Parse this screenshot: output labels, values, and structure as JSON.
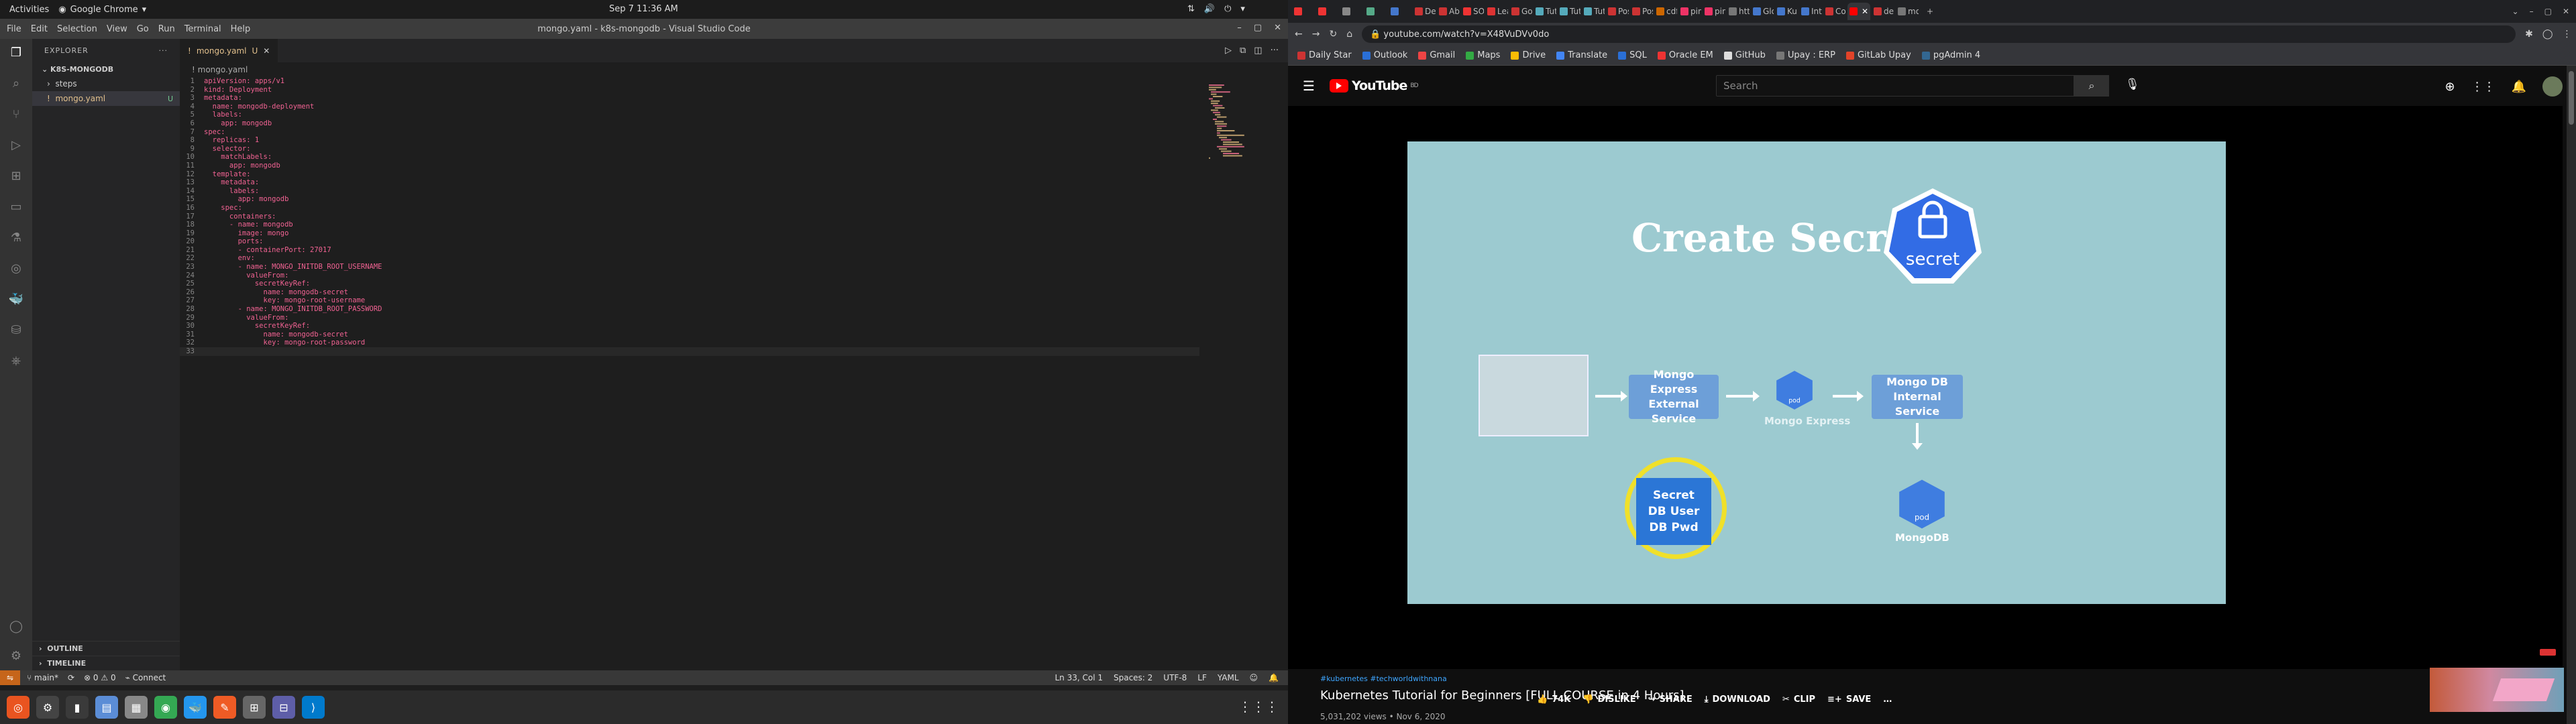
{
  "system": {
    "activities": "Activities",
    "app_name": "Google Chrome",
    "clock": "Sep 7  11:36 AM"
  },
  "vscode": {
    "title": "mongo.yaml - k8s-mongodb - Visual Studio Code",
    "menu": [
      "File",
      "Edit",
      "Selection",
      "View",
      "Go",
      "Run",
      "Terminal",
      "Help"
    ],
    "explorer_label": "EXPLORER",
    "workspace": "K8S-MONGODB",
    "tree": [
      {
        "label": "steps"
      },
      {
        "label": "mongo.yaml",
        "badge": "U"
      }
    ],
    "outline": "OUTLINE",
    "timeline": "TIMELINE",
    "tab": {
      "label": "mongo.yaml",
      "flag": "U"
    },
    "breadcrumb": "mongo.yaml",
    "code_lines": [
      "apiVersion: apps/v1",
      "kind: Deployment",
      "metadata:",
      "  name: mongodb-deployment",
      "  labels:",
      "    app: mongodb",
      "spec:",
      "  replicas: 1",
      "  selector:",
      "    matchLabels:",
      "      app: mongodb",
      "  template:",
      "    metadata:",
      "      labels:",
      "        app: mongodb",
      "    spec:",
      "      containers:",
      "      - name: mongodb",
      "        image: mongo",
      "        ports:",
      "        - containerPort: 27017",
      "        env:",
      "        - name: MONGO_INITDB_ROOT_USERNAME",
      "          valueFrom:",
      "            secretKeyRef:",
      "              name: mongodb-secret",
      "              key: mongo-root-username",
      "        - name: MONGO_INITDB_ROOT_PASSWORD",
      "          valueFrom:",
      "            secretKeyRef:",
      "              name: mongodb-secret",
      "              key: mongo-root-password",
      ""
    ],
    "status": {
      "branch": "main*",
      "problems": "⊗ 0 ⚠ 0",
      "connect": "Connect",
      "position": "Ln 33, Col 1",
      "spaces": "Spaces: 2",
      "encoding": "UTF-8",
      "eol": "LF",
      "language": "YAML"
    }
  },
  "chrome": {
    "tabs": [
      "",
      "",
      "",
      "",
      "",
      "Des",
      "Abs",
      "SOL",
      "Lea",
      "Go t",
      "Tut",
      "Tut",
      "Tut",
      "Pos",
      "Pos",
      "cdf",
      "pin",
      "pin",
      "http",
      "Glo",
      "Kub",
      "Inte",
      "Con",
      "",
      "den",
      "mor"
    ],
    "tab_colors": [
      "#e33",
      "#e33",
      "#888",
      "#5a8",
      "#47c",
      "#c33",
      "#c33",
      "#e33",
      "#d33",
      "#c33",
      "#5ab",
      "#5ab",
      "#5ab",
      "#c33",
      "#c33",
      "#c60",
      "#e36",
      "#e36",
      "#777",
      "#47c",
      "#47c",
      "#47c",
      "#c33",
      "#f00",
      "#c33",
      "#777"
    ],
    "url": "youtube.com/watch?v=X48VuDVv0do",
    "bookmarks": [
      {
        "label": "Daily Star",
        "color": "#c33"
      },
      {
        "label": "Outlook",
        "color": "#2a6fd6"
      },
      {
        "label": "Gmail",
        "color": "#e44"
      },
      {
        "label": "Maps",
        "color": "#3a4"
      },
      {
        "label": "Drive",
        "color": "#fbbc05"
      },
      {
        "label": "Translate",
        "color": "#4285f4"
      },
      {
        "label": "SQL",
        "color": "#2a6fd6"
      },
      {
        "label": "Oracle EM",
        "color": "#e33"
      },
      {
        "label": "GitHub",
        "color": "#ddd"
      },
      {
        "label": "Upay : ERP",
        "color": "#777"
      },
      {
        "label": "GitLab Upay",
        "color": "#e24329"
      },
      {
        "label": "pgAdmin 4",
        "color": "#336791"
      }
    ]
  },
  "youtube": {
    "logo": "YouTube",
    "region": "BD",
    "search_placeholder": "Search",
    "slide": {
      "title": "Create Secret",
      "badge": "secret",
      "n1": "Mongo Express External Service",
      "n2_cap": "Mongo Express",
      "n3": "Mongo DB Internal Service",
      "pod_cap": "MongoDB",
      "pod_label": "pod",
      "pod_label2": "pod",
      "secret": [
        "Secret",
        "DB User",
        "DB Pwd"
      ]
    },
    "hashtags": "#kubernetes #techworldwithnana",
    "video_title": "Kubernetes Tutorial for Beginners [FULL COURSE in 4 Hours]",
    "meta": "5,031,202 views • Nov 6, 2020",
    "actions": {
      "likes": "74K",
      "dislike": "DISLIKE",
      "share": "SHARE",
      "download": "DOWNLOAD",
      "clip": "CLIP",
      "save": "SAVE",
      "more": "…"
    }
  }
}
